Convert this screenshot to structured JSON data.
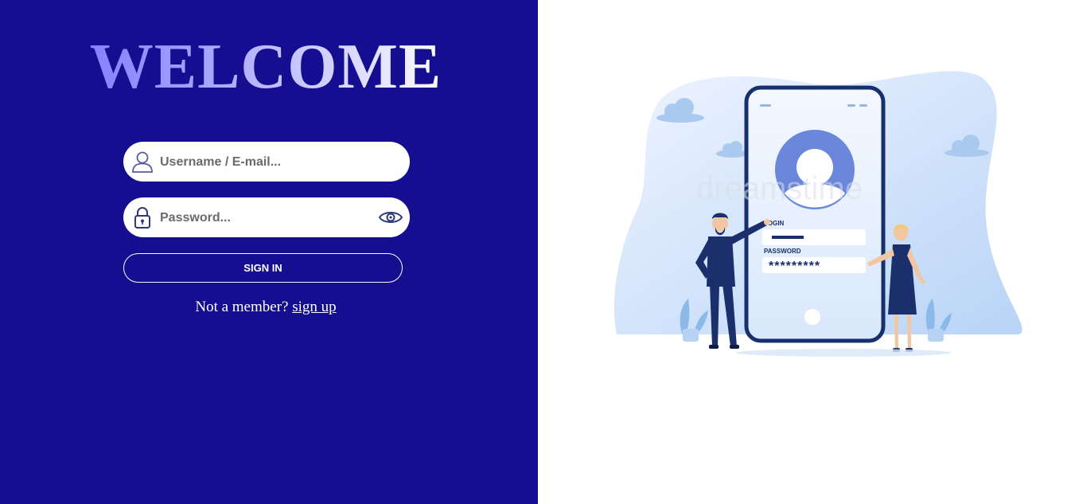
{
  "welcome": {
    "title": "WELCOME"
  },
  "form": {
    "username_placeholder": "Username / E-mail...",
    "password_placeholder": "Password...",
    "signin_label": "SIGN IN",
    "member_text": "Not a member?",
    "signup_link": "sign up"
  },
  "illustration": {
    "login_label": "LOGIN",
    "password_label": "PASSWORD",
    "password_mask": "*********",
    "watermark": "dreamstime"
  },
  "colors": {
    "left_bg": "#150e90",
    "accent_blue": "#6a87dc",
    "navy": "#1a2f6b"
  },
  "icons": {
    "user": "user-icon",
    "lock": "lock-icon",
    "eye": "eye-icon"
  }
}
